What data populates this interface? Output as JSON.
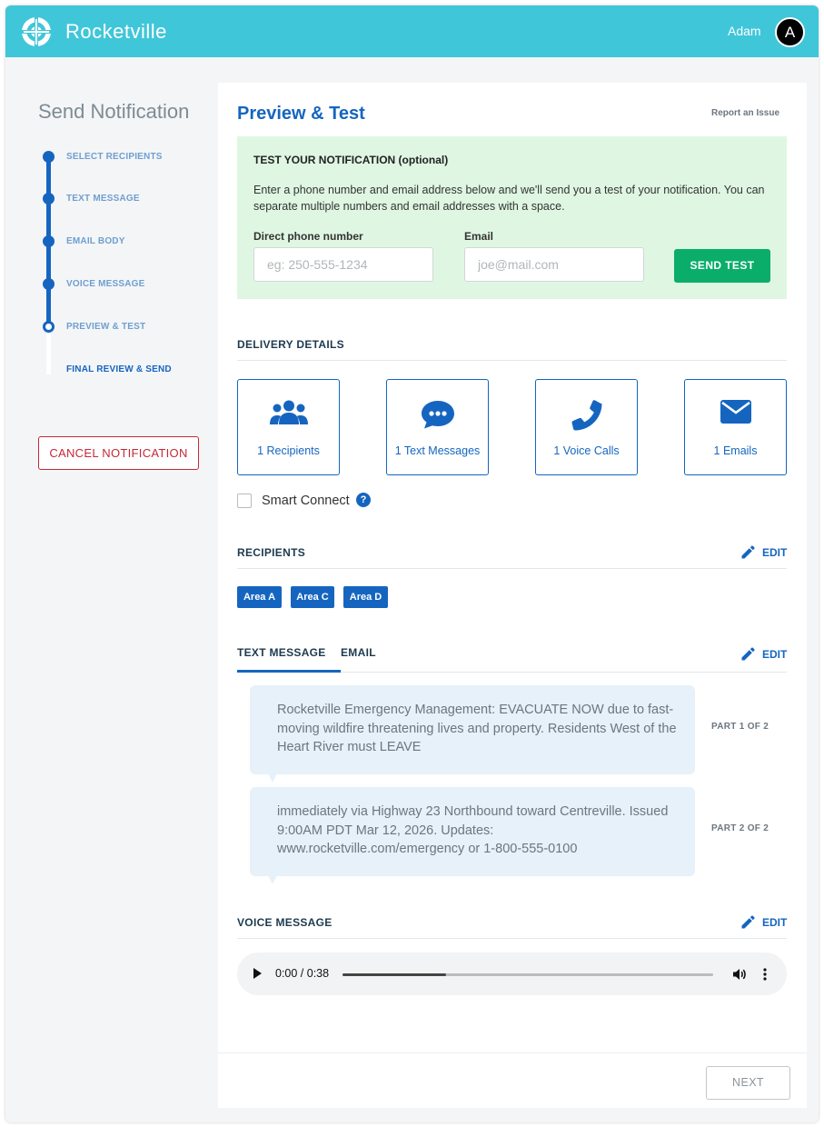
{
  "header": {
    "brand_name": "Rocketville",
    "user_name": "Adam",
    "avatar_initial": "A",
    "bar_color": "#40c6d9"
  },
  "sidebar": {
    "title": "Send Notification",
    "steps": [
      {
        "label": "SELECT RECIPIENTS",
        "state": "done"
      },
      {
        "label": "TEXT MESSAGE",
        "state": "done"
      },
      {
        "label": "EMAIL BODY",
        "state": "done"
      },
      {
        "label": "VOICE MESSAGE",
        "state": "done"
      },
      {
        "label": "PREVIEW & TEST",
        "state": "current"
      },
      {
        "label": "FINAL REVIEW & SEND",
        "state": "upcoming"
      }
    ],
    "cancel_label": "CANCEL NOTIFICATION"
  },
  "main": {
    "title": "Preview & Test",
    "report_link": "Report an Issue",
    "test": {
      "heading": "TEST YOUR NOTIFICATION (optional)",
      "description": "Enter a phone number and email address below and we'll send you a test of your notification. You can separate multiple numbers and email addresses with a space.",
      "phone_label": "Direct phone number",
      "phone_placeholder": "eg: 250-555-1234",
      "phone_value": "",
      "email_label": "Email",
      "email_placeholder": "joe@mail.com",
      "email_value": "",
      "send_label": "SEND TEST"
    },
    "delivery": {
      "heading": "DELIVERY DETAILS",
      "cards": [
        {
          "icon": "users-icon",
          "label": "1 Recipients"
        },
        {
          "icon": "chat-icon",
          "label": "1 Text Messages"
        },
        {
          "icon": "phone-icon",
          "label": "1 Voice Calls"
        },
        {
          "icon": "envelope-icon",
          "label": "1 Emails"
        }
      ],
      "smart_connect_label": "Smart Connect",
      "smart_connect_checked": false,
      "help_glyph": "?"
    },
    "recipients": {
      "heading": "RECIPIENTS",
      "edit_label": "EDIT",
      "chips": [
        "Area A",
        "Area C",
        "Area D"
      ]
    },
    "messages": {
      "tabs": [
        {
          "label": "TEXT MESSAGE",
          "active": true
        },
        {
          "label": "EMAIL",
          "active": false
        }
      ],
      "edit_label": "EDIT",
      "parts": [
        {
          "text": "Rocketville Emergency Management: EVACUATE NOW due to fast-moving wildfire threatening lives and property. Residents West of the Heart River must LEAVE",
          "label": "PART 1 OF 2"
        },
        {
          "text": "immediately via Highway 23 Northbound toward Centreville. Issued 9:00AM PDT Mar 12, 2026. Updates: www.rocketville.com/emergency or 1-800-555-0100",
          "label": "PART 2 OF 2"
        }
      ]
    },
    "voice": {
      "heading": "VOICE MESSAGE",
      "edit_label": "EDIT",
      "time": "0:00 / 0:38",
      "buffered_fraction": 0.28
    },
    "next_label": "NEXT"
  },
  "colors": {
    "accent": "#1565c0",
    "success": "#0bad6b",
    "danger": "#c62838",
    "test_bg": "#dff7e2"
  }
}
